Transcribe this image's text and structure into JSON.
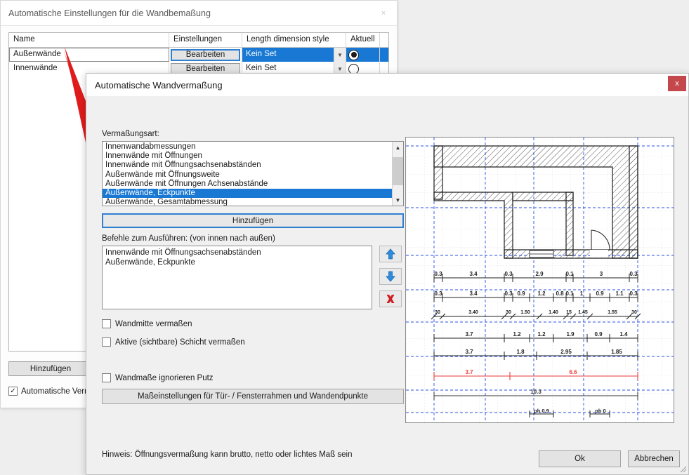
{
  "background_window": {
    "title": "Automatische Einstellungen für die Wandbemaßung",
    "close_label": "×",
    "table": {
      "columns": [
        "Name",
        "Einstellungen",
        "Length dimension style",
        "Aktuell"
      ],
      "rows": [
        {
          "name": "Außenwände",
          "settings_button": "Bearbeiten",
          "style": "Kein Set",
          "current": true
        },
        {
          "name": "Innenwände",
          "settings_button": "Bearbeiten",
          "style": "Kein Set",
          "current": false
        }
      ]
    },
    "add_button": "Hinzufügen",
    "auto_checkbox": {
      "label": "Automatische Vermaß",
      "checked": true,
      "mark": "✓"
    }
  },
  "dialog": {
    "title": "Automatische Wandvermaßung",
    "close_label": "x",
    "dimension_type_label": "Vermaßungsart:",
    "dimension_types": [
      {
        "label": "Innenwandabmessungen",
        "selected": false
      },
      {
        "label": "Innenwände mit Öffnungen",
        "selected": false
      },
      {
        "label": "Innenwände mit Öffnungsachsenabständen",
        "selected": false
      },
      {
        "label": "Außenwände mit Öffnungsweite",
        "selected": false
      },
      {
        "label": "Außenwände mit Öffnungen Achsenabstände",
        "selected": false
      },
      {
        "label": "Außenwände, Eckpunkte",
        "selected": true
      },
      {
        "label": "Außenwände, Gesamtabmessung",
        "selected": false
      }
    ],
    "add_button": "Hinzufügen",
    "commands_label": "Befehle zum Ausführen: (von innen nach außen)",
    "commands": [
      "Innenwände mit Öffnungsachsenabständen",
      "Außenwände, Eckpunkte"
    ],
    "tools": {
      "move_up": "move-up-arrow",
      "move_down": "move-down-arrow",
      "delete": "delete-x"
    },
    "checkboxes": [
      {
        "label": "Wandmitte vermaßen",
        "checked": false
      },
      {
        "label": "Aktive (sichtbare) Schicht vermaßen",
        "checked": false
      },
      {
        "label": "Wandmaße ignorieren Putz",
        "checked": false
      }
    ],
    "measure_settings_button": "Maßeinstellungen für Tür- / Fensterrahmen und Wandendpunkte",
    "hint": "Hinweis: Öffnungsvermaßung kann brutto, netto oder lichtes Maß sein",
    "ok_button": "Ok",
    "cancel_button": "Abbrechen",
    "scroll_up_icon": "chevron-up-icon",
    "scroll_down_icon": "chevron-down-icon"
  },
  "preview": {
    "accent_red": "#ee3b3b",
    "grid_blue": "#2a4fe0",
    "dimension_rows": [
      {
        "id": "row1",
        "color": "#222222",
        "values": [
          "0.3",
          "3.4",
          "0.3",
          "2.9",
          "0.1",
          "3",
          "0.3"
        ]
      },
      {
        "id": "row2",
        "color": "#222222",
        "values": [
          "0.3",
          "3.4",
          "0.3",
          "0.9",
          "1.2",
          "0.8",
          "0.1",
          "1",
          "0.9",
          "1.1",
          "0.3"
        ]
      },
      {
        "id": "row3",
        "color": "#222222",
        "values": [
          "30",
          "3.40",
          "30",
          "1.50",
          "1.40",
          "15",
          "1.45",
          "1.55",
          "30"
        ]
      },
      {
        "id": "row4",
        "color": "#222222",
        "values": [
          "3.7",
          "1.2",
          "1.2",
          "1.9",
          "0.9",
          "1.4"
        ]
      },
      {
        "id": "row5",
        "color": "#222222",
        "values": [
          "3.7",
          "1.8",
          "2.95",
          "1.85"
        ]
      },
      {
        "id": "row6",
        "color": "#ee3b3b",
        "values": [
          "3.7",
          "6.6"
        ]
      },
      {
        "id": "row7",
        "color": "#333333",
        "values": [
          "10.3"
        ]
      },
      {
        "id": "row8",
        "color": "#222222",
        "values": [
          "ph 0.9",
          "ph 0"
        ]
      }
    ]
  }
}
